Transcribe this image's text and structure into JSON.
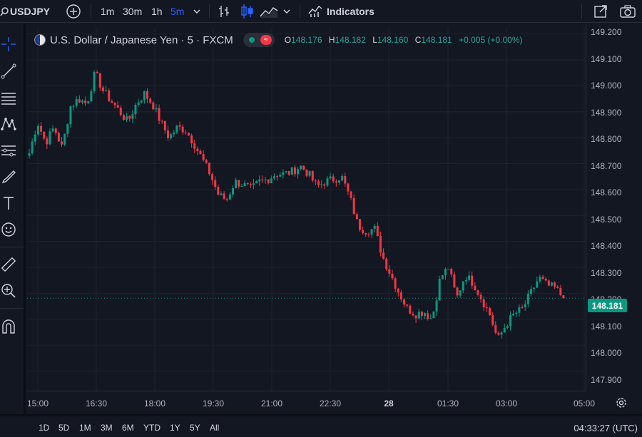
{
  "toolbar": {
    "symbol": "USDJPY",
    "intervals": [
      "1m",
      "30m",
      "1h",
      "5m"
    ],
    "active_interval": "5m",
    "indicators_label": "Indicators"
  },
  "legend": {
    "title": "U.S. Dollar / Japanese Yen · 5 · FXCM",
    "o_label": "O",
    "o_value": "148.176",
    "h_label": "H",
    "h_value": "148.182",
    "l_label": "L",
    "l_value": "148.160",
    "c_label": "C",
    "c_value": "148.181",
    "change": "+0.005 (+0.00%)"
  },
  "price_axis": {
    "labels": [
      "149.200",
      "149.100",
      "149.000",
      "148.900",
      "148.800",
      "148.700",
      "148.600",
      "148.500",
      "148.400",
      "148.300",
      "148.200",
      "148.100",
      "148.000",
      "147.900"
    ],
    "last_price": "148.181"
  },
  "time_axis": {
    "labels": [
      "15:00",
      "16:30",
      "18:00",
      "19:30",
      "21:00",
      "22:30",
      "28",
      "01:30",
      "03:00",
      "05:00"
    ]
  },
  "bottom": {
    "ranges": [
      "1D",
      "5D",
      "1M",
      "3M",
      "6M",
      "YTD",
      "1Y",
      "5Y",
      "All"
    ],
    "clock": "04:33:27 (UTC)"
  },
  "colors": {
    "up": "#089981",
    "down": "#f23645",
    "background": "#131722",
    "accent": "#2962ff"
  },
  "chart_data": {
    "type": "candlestick",
    "x": [
      "15:00",
      "16:30",
      "18:00",
      "19:30",
      "21:00",
      "22:30",
      "28",
      "01:30",
      "03:00",
      "05:00"
    ],
    "ylim": [
      147.86,
      149.21
    ],
    "last_price": 148.181,
    "close_path": [
      148.74,
      148.86,
      148.78,
      148.84,
      148.76,
      148.92,
      148.95,
      148.93,
      149.05,
      148.98,
      148.94,
      148.9,
      148.86,
      148.93,
      148.97,
      148.93,
      148.86,
      148.8,
      148.84,
      148.83,
      148.78,
      148.72,
      148.66,
      148.58,
      148.56,
      148.63,
      148.62,
      148.6,
      148.63,
      148.64,
      148.66,
      148.66,
      148.67,
      148.69,
      148.66,
      148.61,
      148.63,
      148.64,
      148.65,
      148.57,
      148.46,
      148.44,
      148.45,
      148.34,
      148.27,
      148.2,
      148.14,
      148.12,
      148.13,
      148.1,
      148.26,
      148.3,
      148.18,
      148.27,
      148.24,
      148.18,
      148.12,
      148.02,
      148.08,
      148.12,
      148.14,
      148.2,
      148.26,
      148.23,
      148.22,
      148.18
    ]
  }
}
